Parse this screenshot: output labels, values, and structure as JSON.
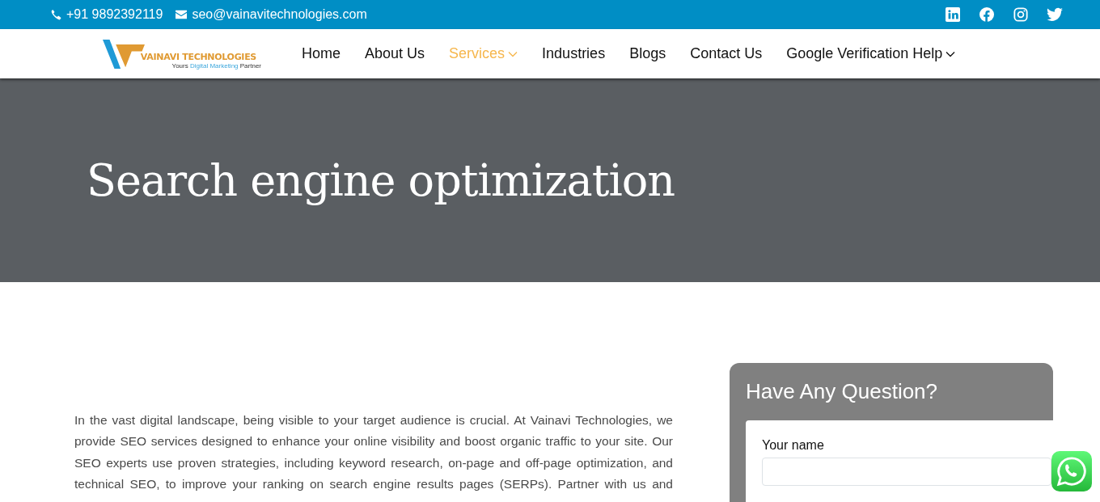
{
  "top_bar": {
    "phone": "+91 9892392119",
    "email": "seo@vainavitechnologies.com",
    "social": [
      {
        "kind": "linkedin"
      },
      {
        "kind": "facebook"
      },
      {
        "kind": "instagram"
      },
      {
        "kind": "twitter"
      }
    ]
  },
  "logo": {
    "name": "VAINAVI TECHNOLOGIES",
    "tagline_start": "Yours",
    "tagline_highlight": "Digital Marketing",
    "tagline_end": "Partner"
  },
  "nav": [
    {
      "label": "Home",
      "selected": false,
      "dropdown": false
    },
    {
      "label": "About Us",
      "selected": false,
      "dropdown": false
    },
    {
      "label": "Services",
      "selected": true,
      "dropdown": true
    },
    {
      "label": "Industries",
      "selected": false,
      "dropdown": false
    },
    {
      "label": "Blogs",
      "selected": false,
      "dropdown": false
    },
    {
      "label": "Contact Us",
      "selected": false,
      "dropdown": false
    },
    {
      "label": "Google Verification Help",
      "selected": false,
      "dropdown": true
    }
  ],
  "hero": {
    "title": "Search engine optimization"
  },
  "intro": "In the vast digital landscape, being visible to your target audience is crucial. At Vainavi Technologies, we provide SEO services designed to enhance your online visibility and boost organic traffic to your site. Our SEO experts use proven strategies, including keyword research, on-page and off-page optimization, and technical SEO, to improve your ranking on search engine results pages (SERPs). Partner with us and",
  "form": {
    "title": "Have Any Question?",
    "fields": [
      {
        "label": "Your name"
      }
    ]
  }
}
